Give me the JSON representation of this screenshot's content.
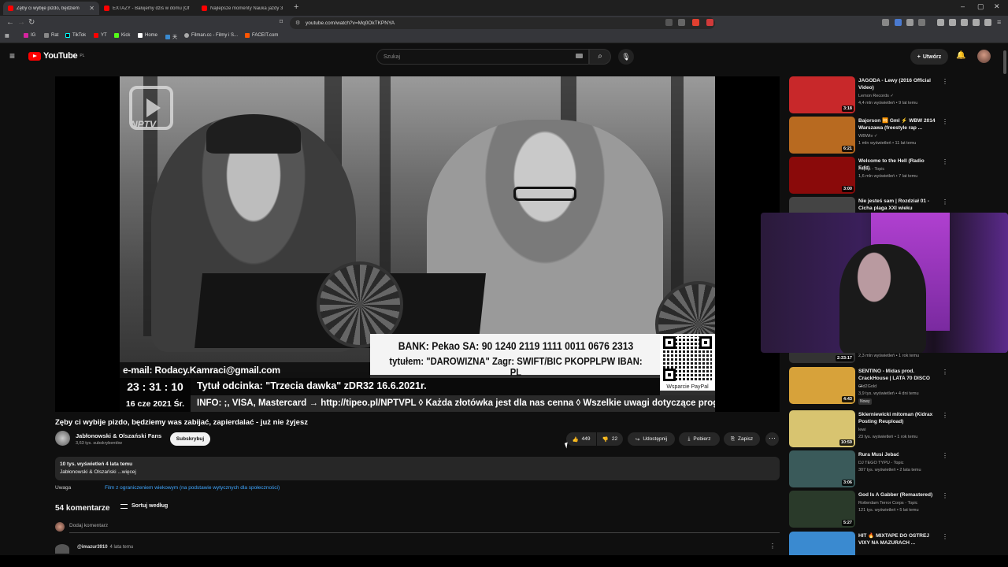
{
  "browser": {
    "tabs": [
      {
        "label": "Zęby ci wybije pizdo, będziem"
      },
      {
        "label": "EXTAZY - Bałujemy dziś w domu [Of"
      },
      {
        "label": "Najlepsze momenty Nauka jazdy 3"
      }
    ],
    "url": "youtube.com/watch?v=Mq0OkTKPNYA",
    "bookmarks": [
      "IG",
      "Rat",
      "TikTok",
      "YT",
      "Kick",
      "Home",
      "天",
      "Filman.cc - Filmy i S...",
      "FACEIT.com"
    ]
  },
  "header": {
    "logo": "YouTube",
    "region": "PL",
    "search_placeholder": "Szukaj",
    "create_label": "Utwórz"
  },
  "video": {
    "overlay_logo": "NPTV",
    "bank_line1": "BANK: Pekao SA: 90 1240 2119 1111 0011 0676 2313",
    "bank_line2": "tytułem: \"DAROWIZNA\"  Zagr: SWIFT/BIC PKOPPLPW  IBAN: PL",
    "email": "e-mail: Rodacy.Kamraci@gmail.com",
    "clock": "23 : 31 : 10",
    "date": "16 cze 2021 Śr.",
    "episode": "Tytuł odcinka: \"Trzecia dawka\" zDR32 16.6.2021r.",
    "ticker": "INFO: ;, VISA, Mastercard → http://tipeo.pl/NPTVPL ◊ Każda złotówka jest dla nas cenna ◊ Wszelkie uwagi dotyczące programu pros",
    "qr_caption": "Wsparcie PayPal"
  },
  "watch": {
    "title": "Zęby ci wybije pizdo, będziemy was zabijać, zapierdalać - już nie żyjesz",
    "channel": "Jabłonowski & Olszański Fans",
    "subscribers": "3,63 tys. subskrybentów",
    "subscribe_label": "Subskrybuj",
    "likes": "449",
    "dislikes": "22",
    "share_label": "Udostępnij",
    "download_label": "Pobierz",
    "save_label": "Zapisz",
    "views_date": "10 tys. wyświetleń  4 lata temu",
    "desc_preview": "Jabłonowski & Olszański ...więcej",
    "notice_label": "Uwaga",
    "notice_link": "Film z ograniczeniem wiekowym (na podstawie wytycznych dla społeczności)",
    "comments_count": "54 komentarze",
    "sort_label": "Sortuj według",
    "add_comment": "Dodaj komentarz",
    "first_comment_user": "@imazur3910",
    "first_comment_time": "4 lata temu"
  },
  "sidebar": [
    {
      "title": "JAGODA - Lewy (2016 Official Video)",
      "channel": "Lemon Records ✓",
      "meta": "4,4 mln wyświetleń • 9 lat temu",
      "duration": "3:18",
      "color": "#c8282a"
    },
    {
      "title": "Bajorson 🆚 Gml ⚡ WBW 2014 Warszawa (freestyle rap ...",
      "channel": "WBWtv ✓",
      "meta": "1 mln wyświetleń • 11 lat temu",
      "duration": "6:21",
      "color": "#b86a20"
    },
    {
      "title": "Welcome to the Hell (Radio Edit)",
      "channel": "Popek - Topic",
      "meta": "1,6 mln wyświetleń • 7 lat temu",
      "duration": "3:00",
      "color": "#8a0a0a"
    },
    {
      "title": "Nie jesteś sam | Rozdział 01 - Cicha plaga XXI wieku",
      "channel": "",
      "meta": "",
      "duration": "",
      "color": "#444"
    },
    {
      "title": "",
      "channel": "",
      "meta": "2,3 mln wyświetleń • 1 rok temu",
      "duration": "2:33:17",
      "color": "#333"
    },
    {
      "title": "SENTINO - Midas prod. CrackHouse | LATA 70 DISCO ...",
      "channel": "Old2Gold",
      "meta": "3,9 tys. wyświetleń • 4 dni temu",
      "badge": "Nowy",
      "duration": "4:43",
      "color": "#d7a23a"
    },
    {
      "title": "Skierniewicki mitoman (Kidrax Posting Reupload)",
      "channel": "lewi",
      "meta": "23 tys. wyświetleń • 1 rok temu",
      "duration": "10:59",
      "color": "#d8c470"
    },
    {
      "title": "Rura Musi Jebać",
      "channel": "DJ TEGO TYPU - Topic",
      "meta": "307 tys. wyświetleń • 2 lata temu",
      "duration": "3:06",
      "color": "#3a5a5a"
    },
    {
      "title": "God Is A Gabber (Remastered)",
      "channel": "Rotterdam Terror Corps - Topic",
      "meta": "121 tys. wyświetleń • 5 lat temu",
      "duration": "5:27",
      "color": "#2a3a2a"
    },
    {
      "title": "HIT 🔥 MIXTAPE DO OSTREJ VIXY NA MAZURACH ...",
      "channel": "",
      "meta": "",
      "duration": "",
      "color": "#3a8ad0"
    }
  ]
}
